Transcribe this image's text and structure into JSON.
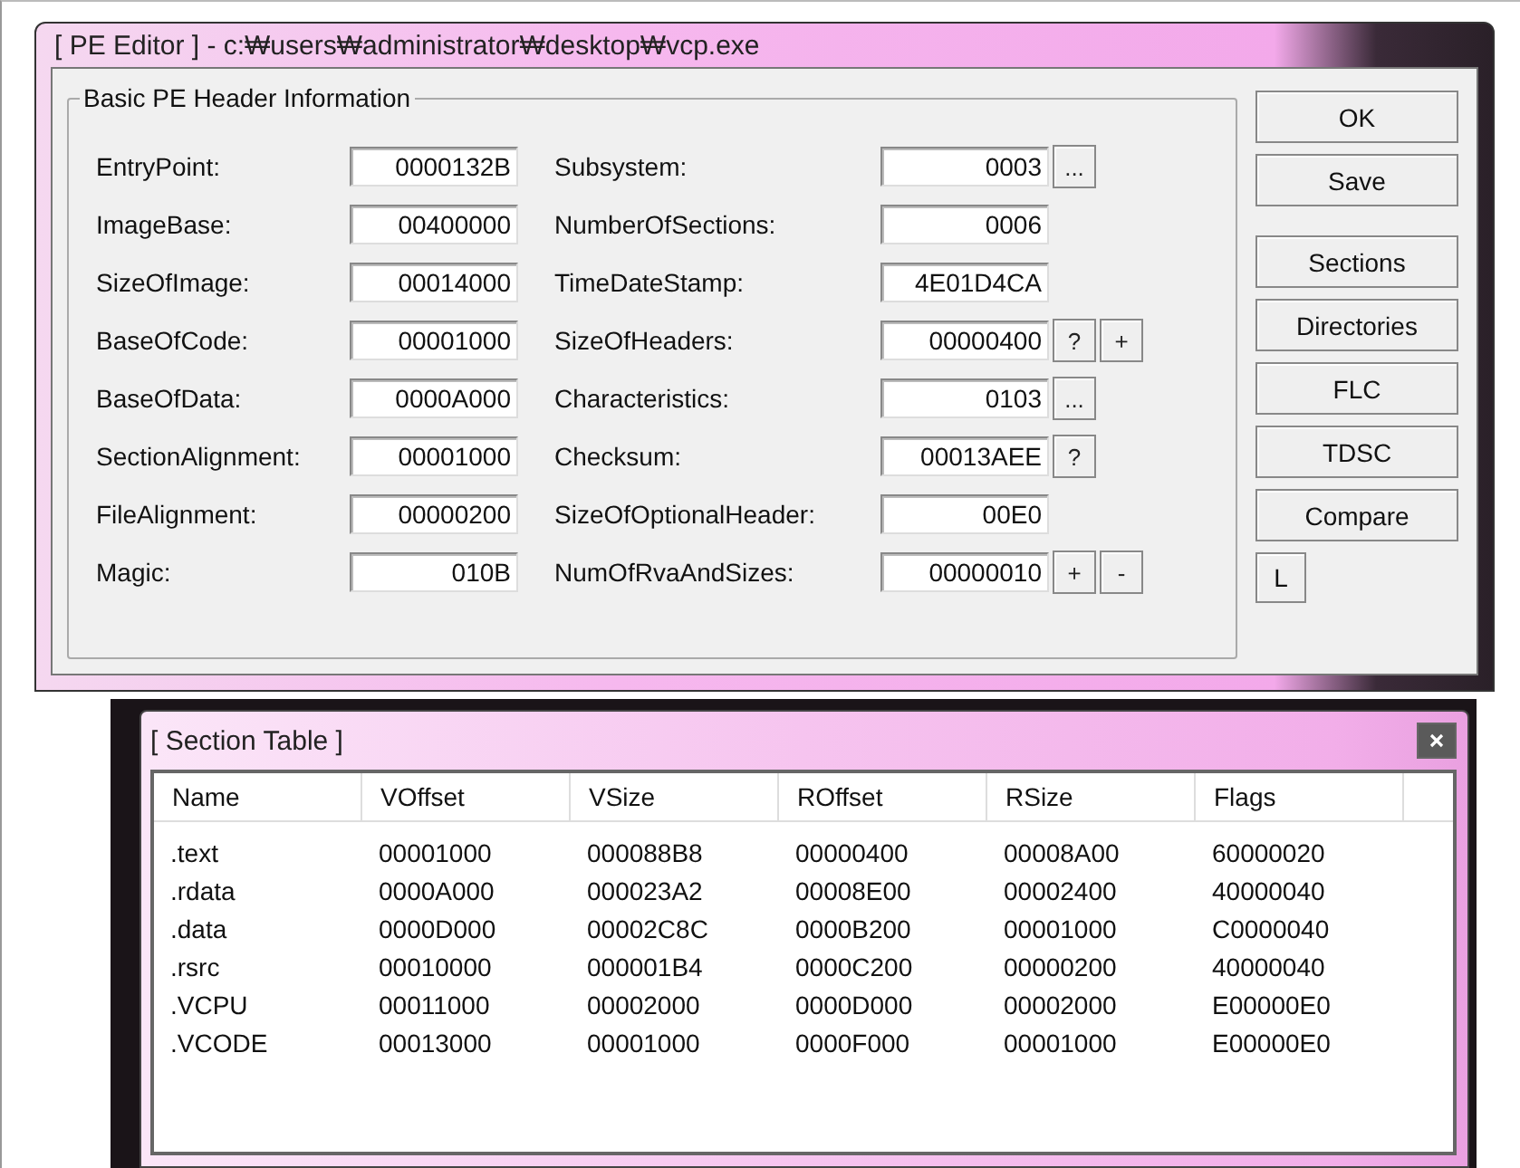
{
  "window": {
    "title": "[ PE Editor ] - c:₩users₩administrator₩desktop₩vcp.exe"
  },
  "header_group": {
    "title": "Basic PE Header Information",
    "left_fields": [
      {
        "label": "EntryPoint:",
        "value": "0000132B"
      },
      {
        "label": "ImageBase:",
        "value": "00400000"
      },
      {
        "label": "SizeOfImage:",
        "value": "00014000"
      },
      {
        "label": "BaseOfCode:",
        "value": "00001000"
      },
      {
        "label": "BaseOfData:",
        "value": "0000A000"
      },
      {
        "label": "SectionAlignment:",
        "value": "00001000"
      },
      {
        "label": "FileAlignment:",
        "value": "00000200"
      },
      {
        "label": "Magic:",
        "value": "010B"
      }
    ],
    "right_fields": [
      {
        "label": "Subsystem:",
        "value": "0003",
        "buttons": [
          "..."
        ]
      },
      {
        "label": "NumberOfSections:",
        "value": "0006"
      },
      {
        "label": "TimeDateStamp:",
        "value": "4E01D4CA"
      },
      {
        "label": "SizeOfHeaders:",
        "value": "00000400",
        "buttons": [
          "?",
          "+"
        ]
      },
      {
        "label": "Characteristics:",
        "value": "0103",
        "buttons": [
          "..."
        ]
      },
      {
        "label": "Checksum:",
        "value": "00013AEE",
        "buttons": [
          "?"
        ]
      },
      {
        "label": "SizeOfOptionalHeader:",
        "value": "00E0"
      },
      {
        "label": "NumOfRvaAndSizes:",
        "value": "00000010",
        "buttons": [
          "+",
          "-"
        ]
      }
    ]
  },
  "side_button_groups": [
    [
      "OK",
      "Save"
    ],
    [
      "Sections",
      "Directories",
      "FLC",
      "TDSC",
      "Compare"
    ]
  ],
  "small_button": "L",
  "section_table": {
    "title": "[ Section Table ]",
    "columns": [
      "Name",
      "VOffset",
      "VSize",
      "ROffset",
      "RSize",
      "Flags"
    ],
    "rows": [
      [
        ".text",
        "00001000",
        "000088B8",
        "00000400",
        "00008A00",
        "60000020"
      ],
      [
        ".rdata",
        "0000A000",
        "000023A2",
        "00008E00",
        "00002400",
        "40000040"
      ],
      [
        ".data",
        "0000D000",
        "00002C8C",
        "0000B200",
        "00001000",
        "C0000040"
      ],
      [
        ".rsrc",
        "00010000",
        "000001B4",
        "0000C200",
        "00000200",
        "40000040"
      ],
      [
        ".VCPU",
        "00011000",
        "00002000",
        "0000D000",
        "00002000",
        "E00000E0"
      ],
      [
        ".VCODE",
        "00013000",
        "00001000",
        "0000F000",
        "00001000",
        "E00000E0"
      ]
    ]
  }
}
